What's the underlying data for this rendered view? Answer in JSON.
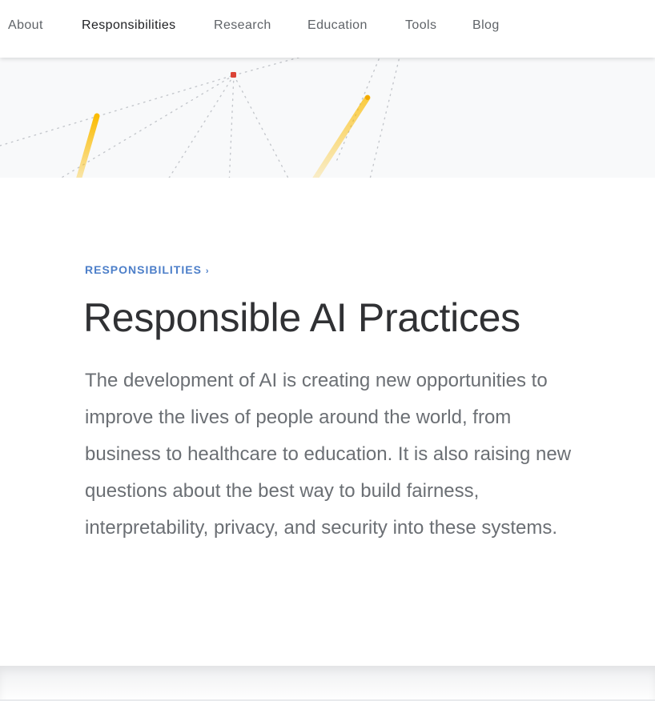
{
  "nav": {
    "items": [
      {
        "label": "About"
      },
      {
        "label": "Responsibilities"
      },
      {
        "label": "Research"
      },
      {
        "label": "Education"
      },
      {
        "label": "Tools"
      },
      {
        "label": "Blog"
      }
    ],
    "active": "Responsibilities"
  },
  "hero": {
    "colors": {
      "background": "#f8f9fa",
      "dots": "#c4c7cc",
      "red_node": "#db4437",
      "yellow": "#fbbc04"
    }
  },
  "main": {
    "eyebrow": "RESPONSIBILITIES",
    "eyebrow_chevron_icon": "chevron-right-icon",
    "title": "Responsible AI Practices",
    "intro": "The development of AI is creating new opportunities to improve the lives of people around the world, from business to healthcare to education. It is also raising new questions about the best way to build fairness, interpretability, privacy, and security into these systems."
  },
  "colors": {
    "eyebrow": "#4d7fc9",
    "title": "#303134",
    "body_text": "#6b6f74",
    "nav_text": "#5f6368",
    "nav_active": "#202124"
  }
}
